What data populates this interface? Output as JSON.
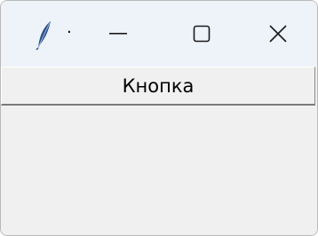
{
  "window": {
    "title": "·",
    "icon": "feather-icon",
    "controls": {
      "minimize_icon": "minimize-icon",
      "maximize_icon": "maximize-icon",
      "close_icon": "close-icon"
    }
  },
  "main": {
    "button_label": "Кнопка"
  },
  "colors": {
    "titlebar": "#eef2f9",
    "window_bg": "#f0f0f0",
    "feather": "#2a4f8a"
  }
}
